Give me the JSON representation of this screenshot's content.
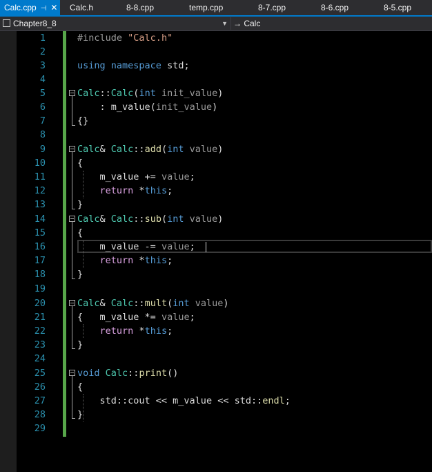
{
  "tabs": [
    {
      "label": "Calc.cpp",
      "active": true,
      "pinned": true
    },
    {
      "label": "Calc.h"
    },
    {
      "label": "8-8.cpp"
    },
    {
      "label": "temp.cpp"
    },
    {
      "label": "8-7.cpp"
    },
    {
      "label": "8-6.cpp"
    },
    {
      "label": "8-5.cpp"
    }
  ],
  "nav": {
    "project": "Chapter8_8",
    "scope": "Calc",
    "scope_arrow": "→"
  },
  "editor": {
    "line_numbers": [
      "1",
      "2",
      "3",
      "4",
      "5",
      "6",
      "7",
      "8",
      "9",
      "10",
      "11",
      "12",
      "13",
      "14",
      "15",
      "16",
      "17",
      "18",
      "19",
      "20",
      "21",
      "22",
      "23",
      "24",
      "25",
      "26",
      "27",
      "28",
      "29"
    ],
    "current_line": 16
  },
  "colors": {
    "accent": "#007acc",
    "editor_bg": "#000000",
    "line_number": "#2b91af",
    "changes_bar": "#57a64a",
    "keyword": "#569cd6",
    "type": "#4ec9b0",
    "function": "#dcdcaa",
    "string": "#d69d85",
    "control_keyword": "#d8a0df"
  }
}
